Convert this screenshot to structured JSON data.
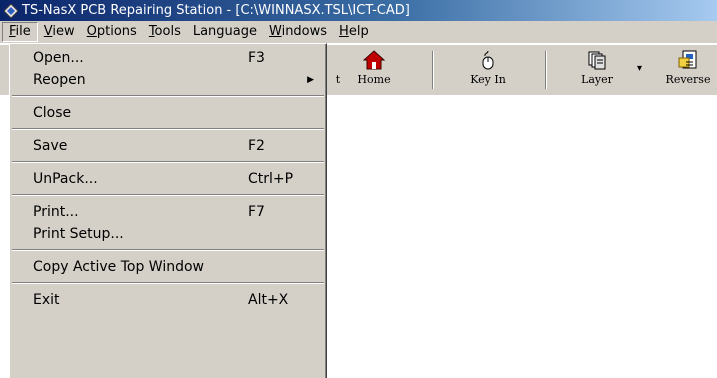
{
  "window": {
    "title": "TS-NasX PCB Repairing Station - [C:\\WINNASX.TSL\\ICT-CAD]"
  },
  "menubar": {
    "items": [
      {
        "label": "File",
        "acc": "F",
        "rest": "ile"
      },
      {
        "label": "View",
        "acc": "V",
        "rest": "iew"
      },
      {
        "label": "Options",
        "acc": "O",
        "rest": "ptions"
      },
      {
        "label": "Tools",
        "acc": "T",
        "rest": "ools"
      },
      {
        "label": "Language",
        "acc": "",
        "rest": "Language"
      },
      {
        "label": "Windows",
        "acc": "W",
        "rest": "indows"
      },
      {
        "label": "Help",
        "acc": "H",
        "rest": "elp"
      }
    ]
  },
  "toolbar": {
    "partial_label": "t",
    "home_label": "Home",
    "keyin_label": "Key In",
    "layer_label": "Layer",
    "reverse_label": "Reverse",
    "dropdown_glyph": "▾"
  },
  "file_menu": {
    "open": {
      "label": "Open...",
      "shortcut": "F3"
    },
    "reopen": {
      "label": "Reopen",
      "arrow": "▶"
    },
    "close": {
      "label": "Close"
    },
    "save": {
      "label": "Save",
      "shortcut": "F2"
    },
    "unpack": {
      "label": "UnPack...",
      "shortcut": "Ctrl+P"
    },
    "print": {
      "label": "Print...",
      "shortcut": "F7"
    },
    "print_setup": {
      "label": "Print Setup..."
    },
    "copy_window": {
      "label": "Copy Active Top Window"
    },
    "exit": {
      "label": "Exit",
      "shortcut": "Alt+X"
    }
  },
  "colors": {
    "titlebar_start": "#0a246a",
    "titlebar_end": "#a6caf0",
    "face": "#d4d0c8",
    "home_icon": "#c00000"
  },
  "icons": {
    "app": "app-diamond-icon",
    "home": "home-icon",
    "keyin": "mouse-icon",
    "layer": "layers-icon",
    "reverse": "reverse-icon"
  }
}
